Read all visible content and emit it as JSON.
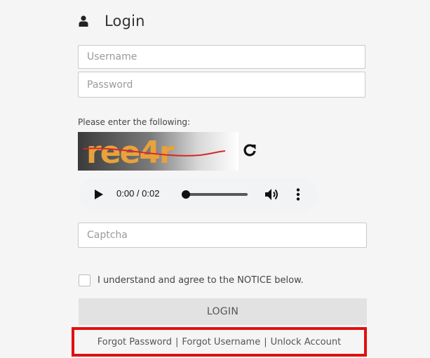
{
  "header": {
    "title": "Login"
  },
  "form": {
    "username_placeholder": "Username",
    "password_placeholder": "Password",
    "captcha_prompt": "Please enter the following:",
    "captcha_image_text": "ree4r",
    "captcha_placeholder": "Captcha",
    "agree_label": "I understand and agree to the NOTICE below.",
    "login_label": "LOGIN"
  },
  "audio": {
    "time_display": "0:00 / 0:02",
    "progress": 0
  },
  "links": {
    "forgot_password": "Forgot Password",
    "forgot_username": "Forgot Username",
    "unlock_account": "Unlock Account",
    "separator": "|"
  },
  "icons": {
    "user": "user-icon",
    "refresh": "refresh-icon",
    "play": "play-icon",
    "volume": "volume-icon",
    "more": "more-vertical-icon"
  },
  "colors": {
    "page_bg": "#f5f5f5",
    "button_bg": "#e2e2e2",
    "highlight_border": "#e01010",
    "audio_bg": "#f1f3f4"
  }
}
